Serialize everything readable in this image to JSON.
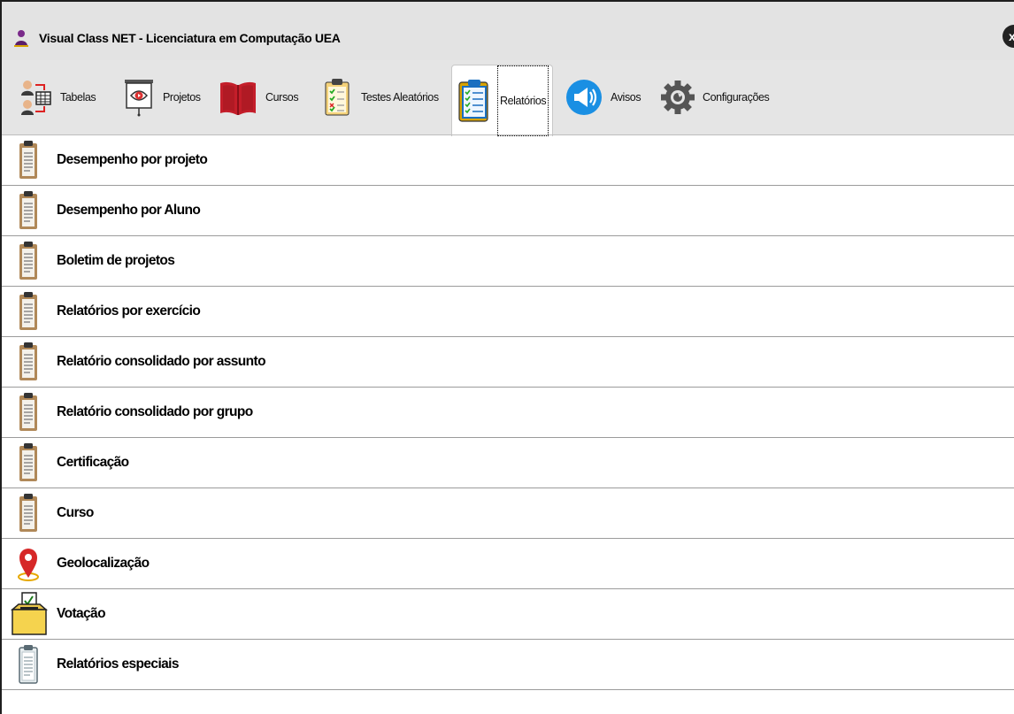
{
  "window": {
    "title": "Visual Class NET - Licenciatura em Computação UEA",
    "close_label": "x"
  },
  "ribbon": {
    "tabs": [
      {
        "label": "Tabelas",
        "icon": "tables-users-icon"
      },
      {
        "label": "Projetos",
        "icon": "presentation-board-icon"
      },
      {
        "label": "Cursos",
        "icon": "open-book-icon"
      },
      {
        "label": "Testes Aleatórios",
        "icon": "checklist-clipboard-icon"
      },
      {
        "label": "Relatórios",
        "icon": "report-clipboard-icon",
        "active": true
      },
      {
        "label": "Avisos",
        "icon": "megaphone-icon"
      },
      {
        "label": "Configurações",
        "icon": "gear-icon"
      }
    ]
  },
  "reports": [
    {
      "label": "Desempenho por projeto",
      "icon": "clipboard-icon"
    },
    {
      "label": "Desempenho por Aluno",
      "icon": "clipboard-icon"
    },
    {
      "label": "Boletim de projetos",
      "icon": "clipboard-icon"
    },
    {
      "label": "Relatórios por exercício",
      "icon": "clipboard-icon"
    },
    {
      "label": "Relatório consolidado por assunto",
      "icon": "clipboard-icon"
    },
    {
      "label": "Relatório consolidado por grupo",
      "icon": "clipboard-icon"
    },
    {
      "label": "Certificação",
      "icon": "clipboard-icon"
    },
    {
      "label": "Curso",
      "icon": "clipboard-icon"
    },
    {
      "label": "Geolocalização",
      "icon": "map-pin-icon"
    },
    {
      "label": "Votação",
      "icon": "ballot-box-icon"
    },
    {
      "label": "Relatórios especiais",
      "icon": "white-clipboard-icon"
    }
  ],
  "colors": {
    "titlebar": "#e3e3e3",
    "ribbon": "#e5e5e5",
    "row_divider": "#9b9b9b",
    "accent_blue": "#1a8fe3"
  }
}
